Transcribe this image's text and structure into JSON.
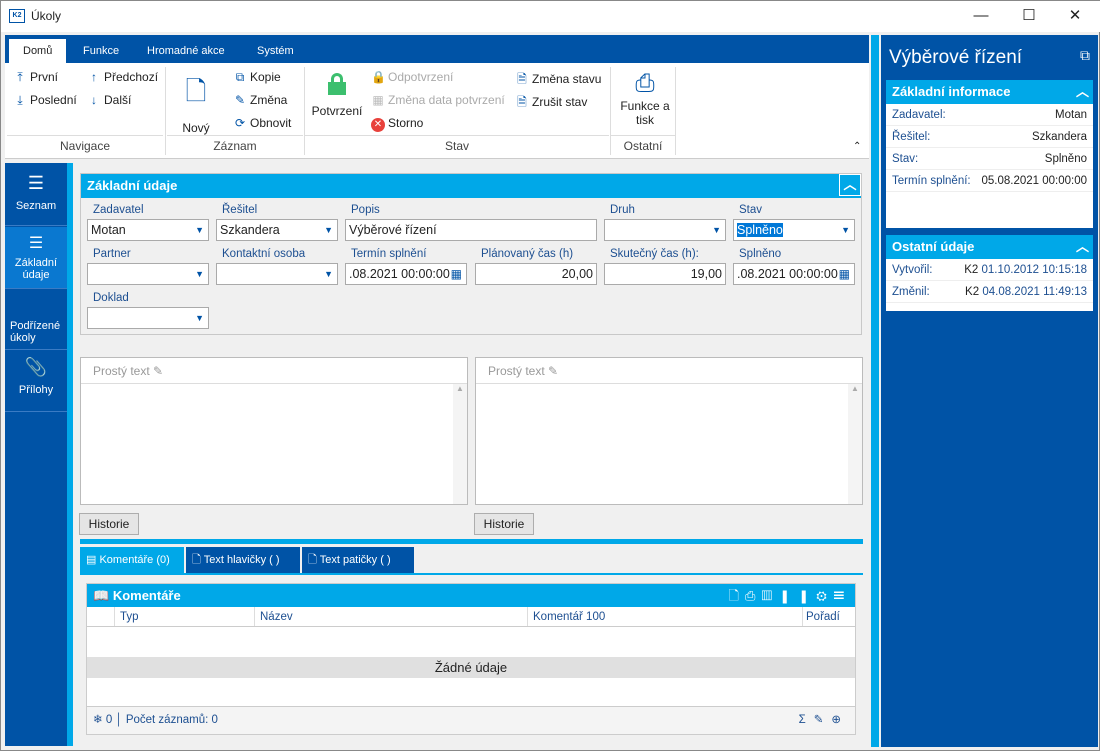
{
  "window": {
    "title": "Úkoly",
    "minimize": "—",
    "maximize": "☐",
    "close": "✕"
  },
  "ribbon": {
    "tabs": [
      "Domů",
      "Funkce",
      "Hromadné akce",
      "Systém"
    ],
    "nav": {
      "first": "První",
      "last": "Poslední",
      "prev": "Předchozí",
      "next": "Další",
      "group": "Navigace"
    },
    "record": {
      "new": "Nový",
      "copy": "Kopie",
      "edit": "Změna",
      "refresh": "Obnovit",
      "group": "Záznam"
    },
    "state": {
      "confirm": "Potvrzení",
      "unconfirm": "Odpotvrzení",
      "change_date": "Změna data potvrzení",
      "storno": "Storno",
      "change_state": "Změna stavu",
      "cancel_state": "Zrušit stav",
      "group": "Stav"
    },
    "other": {
      "print": "Funkce a tisk",
      "group": "Ostatní"
    }
  },
  "sidebar": {
    "items": [
      {
        "label": "Seznam"
      },
      {
        "label": "Základní údaje"
      },
      {
        "label": "Podřízené úkoly"
      },
      {
        "label": "Přílohy"
      }
    ]
  },
  "form": {
    "title": "Základní údaje",
    "fields": {
      "zadavatel": {
        "label": "Zadavatel",
        "value": "Motan"
      },
      "resitel": {
        "label": "Řešitel",
        "value": "Szkandera"
      },
      "popis": {
        "label": "Popis",
        "value": "Výběrové řízení"
      },
      "druh": {
        "label": "Druh",
        "value": ""
      },
      "stav": {
        "label": "Stav",
        "value": "Splněno"
      },
      "partner": {
        "label": "Partner",
        "value": ""
      },
      "kontakt": {
        "label": "Kontaktní osoba",
        "value": ""
      },
      "termin": {
        "label": "Termín splnění",
        "value": ".08.2021 00:00:00"
      },
      "planovany": {
        "label": "Plánovaný čas (h)",
        "value": "20,00"
      },
      "skutecny": {
        "label": "Skutečný čas (h):",
        "value": "19,00"
      },
      "splneno": {
        "label": "Splněno",
        "value": ".08.2021 00:00:00"
      },
      "doklad": {
        "label": "Doklad",
        "value": ""
      }
    }
  },
  "editors": [
    {
      "format": "Prostý text",
      "history": "Historie"
    },
    {
      "format": "Prostý text",
      "history": "Historie"
    }
  ],
  "bottom_tabs": [
    "Komentáře (0)",
    "Text hlavičky ( )",
    "Text patičky ( )"
  ],
  "comments": {
    "title": "Komentáře",
    "columns": [
      "Typ",
      "Název",
      "Komentář 100",
      "Pořadí"
    ],
    "empty": "Žádné údaje",
    "count": "0",
    "records": "Počet záznamů: 0"
  },
  "right_panel": {
    "title": "Výběrové řízení",
    "basic": {
      "title": "Základní informace",
      "rows": [
        {
          "k": "Zadavatel:",
          "v": "Motan"
        },
        {
          "k": "Řešitel:",
          "v": "Szkandera"
        },
        {
          "k": "Stav:",
          "v": "Splněno"
        },
        {
          "k": "Termín splnění:",
          "v": "05.08.2021 00:00:00"
        }
      ]
    },
    "other": {
      "title": "Ostatní údaje",
      "rows": [
        {
          "k": "Vytvořil:",
          "u": "K2",
          "v": "01.10.2012 10:15:18"
        },
        {
          "k": "Změnil:",
          "u": "K2",
          "v": "04.08.2021 11:49:13"
        }
      ]
    }
  },
  "colors": {
    "dark_blue": "#0053a6",
    "accent": "#00a8e8",
    "confirm_green": "#3cbf6e",
    "storno_red": "#e8413b"
  }
}
